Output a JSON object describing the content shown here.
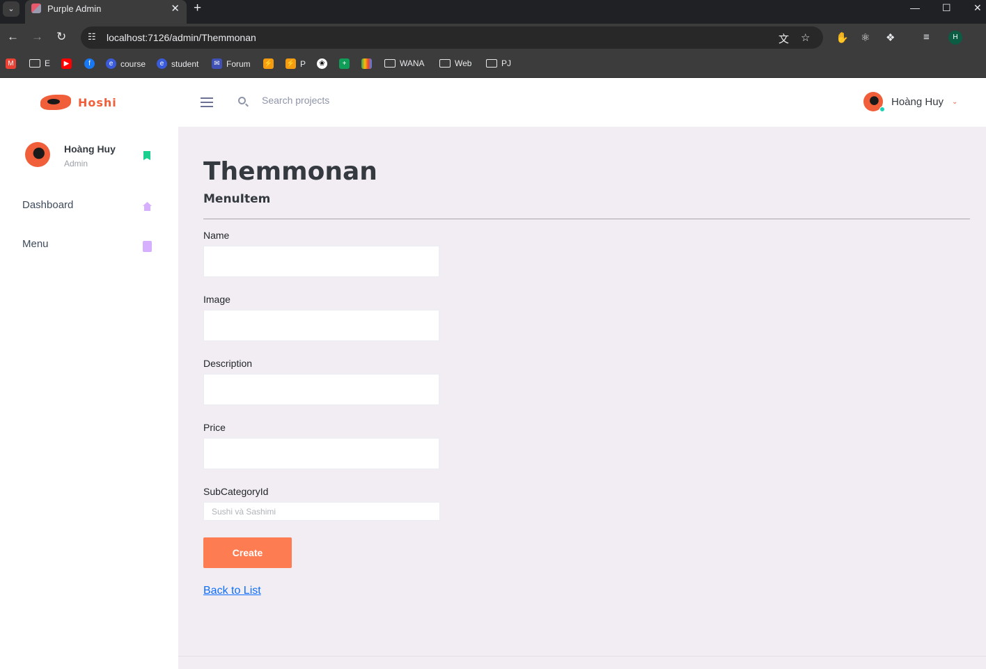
{
  "browser": {
    "tab_title": "Purple Admin",
    "url": "localhost:7126/admin/Themmonan",
    "profile_initial": "H",
    "bookmarks": [
      {
        "label": "",
        "icon": "gmail-icon"
      },
      {
        "label": "E",
        "icon": "folder-icon"
      },
      {
        "label": "",
        "icon": "youtube-icon"
      },
      {
        "label": "",
        "icon": "facebook-icon"
      },
      {
        "label": "course",
        "icon": "edge-icon"
      },
      {
        "label": "student",
        "icon": "edge-icon"
      },
      {
        "label": "Forum",
        "icon": "forum-icon"
      },
      {
        "label": "",
        "icon": "lightning-icon"
      },
      {
        "label": "P",
        "icon": "lightning-icon"
      },
      {
        "label": "",
        "icon": "openai-icon"
      },
      {
        "label": "",
        "icon": "sheets-icon"
      },
      {
        "label": "",
        "icon": "meet-icon"
      },
      {
        "label": "WANA",
        "icon": "folder-icon"
      },
      {
        "label": "Web",
        "icon": "folder-icon"
      },
      {
        "label": "PJ",
        "icon": "folder-icon"
      }
    ]
  },
  "navbar": {
    "brand": "Hoshi",
    "search_placeholder": "Search projects",
    "user_name": "Hoàng Huy"
  },
  "sidebar": {
    "profile_name": "Hoàng Huy",
    "profile_role": "Admin",
    "items": [
      {
        "label": "Dashboard",
        "icon": "home-icon"
      },
      {
        "label": "Menu",
        "icon": "contacts-icon"
      }
    ]
  },
  "page": {
    "title": "Themmonan",
    "subtitle": "MenuItem",
    "fields": {
      "name_label": "Name",
      "image_label": "Image",
      "description_label": "Description",
      "price_label": "Price",
      "subcategory_label": "SubCategoryId",
      "subcategory_value": "Sushi và Sashimi"
    },
    "create_label": "Create",
    "back_label": "Back to List"
  },
  "colors": {
    "accent": "#fe7c52",
    "brand": "#f05e3a",
    "content_bg": "#f2edf3",
    "link": "#0d6efd"
  }
}
